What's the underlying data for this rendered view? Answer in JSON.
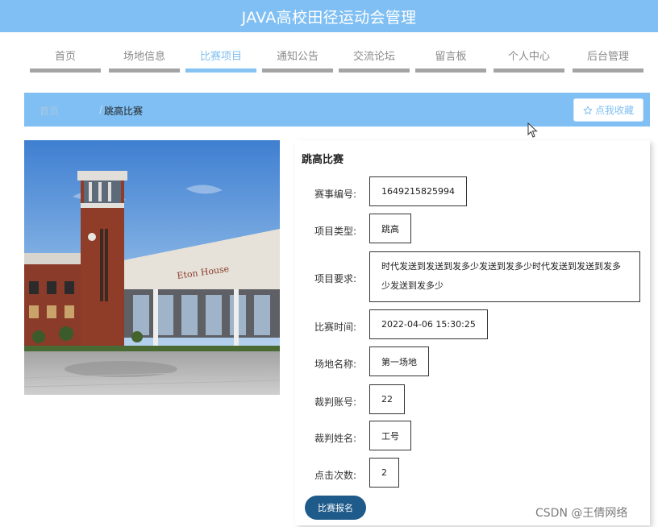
{
  "header": {
    "title": "JAVA高校田径运动会管理"
  },
  "nav": {
    "items": [
      {
        "label": "首页"
      },
      {
        "label": "场地信息"
      },
      {
        "label": "比赛项目"
      },
      {
        "label": "通知公告"
      },
      {
        "label": "交流论坛"
      },
      {
        "label": "留言板"
      },
      {
        "label": "个人中心"
      },
      {
        "label": "后台管理"
      }
    ],
    "active": "比赛项目"
  },
  "breadcrumb": {
    "home": "首页",
    "separator": "/",
    "current": "跳高比赛"
  },
  "favorite_button": {
    "icon": "star-outline-icon",
    "label": "点我收藏"
  },
  "detail": {
    "title": "跳高比赛",
    "fields": [
      {
        "label": "赛事编号:",
        "value": "1649215825994"
      },
      {
        "label": "项目类型:",
        "value": "跳高"
      },
      {
        "label": "项目要求:",
        "value": "时代发送到发送到发多少发送到发多少时代发送到发送到发多少发送到发多少"
      },
      {
        "label": "比赛时间:",
        "value": "2022-04-06 15:30:25"
      },
      {
        "label": "场地名称:",
        "value": "第一场地"
      },
      {
        "label": "裁判账号:",
        "value": "22"
      },
      {
        "label": "裁判姓名:",
        "value": "工号"
      },
      {
        "label": "点击次数:",
        "value": "2"
      }
    ],
    "apply_label": "比赛报名"
  },
  "photo": {
    "building_sign": "Eton House"
  },
  "watermark": "CSDN @王倩网络",
  "colors": {
    "header": "#7fbff3",
    "nav_active": "#86c3f2",
    "nav_bar": "#a4a4a4",
    "apply": "#1f5b8a"
  }
}
